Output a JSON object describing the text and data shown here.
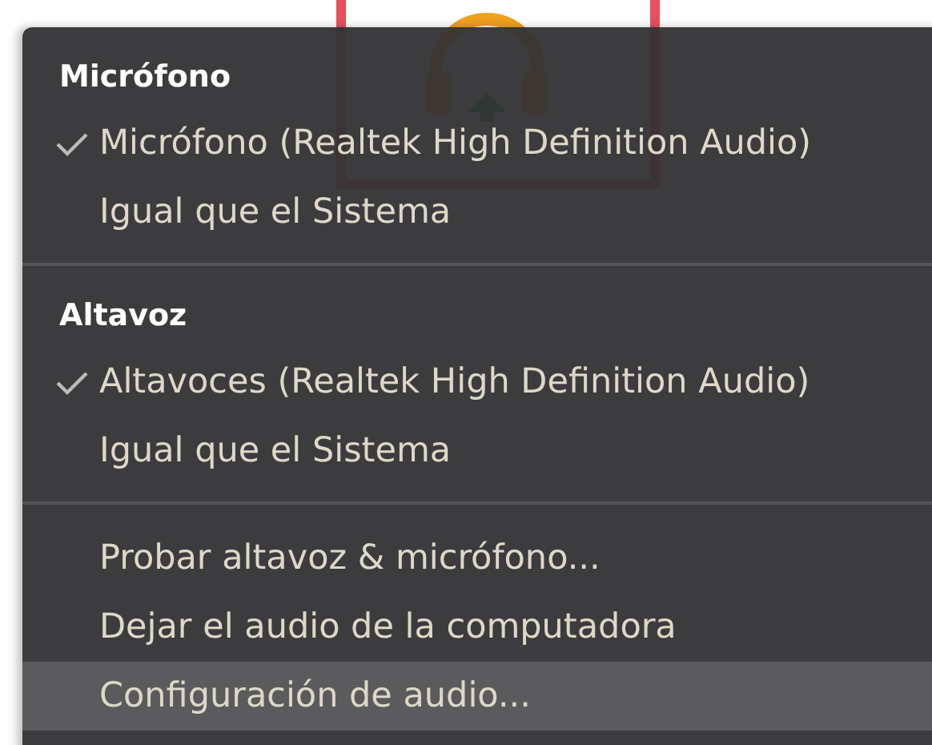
{
  "menu": {
    "sections": [
      {
        "header": "Micrófono",
        "items": [
          {
            "label": "Micrófono (Realtek High Definition Audio)",
            "checked": true
          },
          {
            "label": "Igual que el Sistema",
            "checked": false
          }
        ]
      },
      {
        "header": "Altavoz",
        "items": [
          {
            "label": "Altavoces (Realtek High Definition Audio)",
            "checked": true
          },
          {
            "label": "Igual que el Sistema",
            "checked": false
          }
        ]
      }
    ],
    "actions": [
      {
        "label": "Probar altavoz & micrófono...",
        "selected": false
      },
      {
        "label": "Dejar el audio de la computadora",
        "selected": false
      },
      {
        "label": "Configuración de audio...",
        "selected": true
      }
    ]
  }
}
